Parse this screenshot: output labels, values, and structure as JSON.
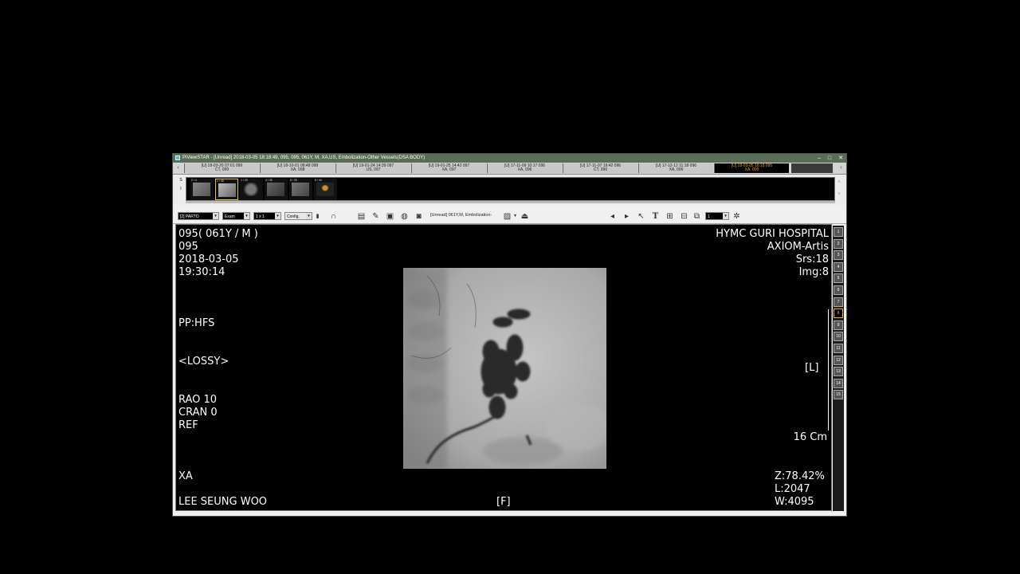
{
  "window": {
    "title": "PiViewSTAR - [Unread] 2018-03-05 18:18:49, 095, 095, 061Y, M, XA,US, Embolization-Other Vessels(DSA BODY)",
    "controls": [
      "–",
      "□",
      "✕"
    ]
  },
  "tabs": [
    {
      "line1": "[U] 18-03-20 07:01  099",
      "line2": "CT, 099",
      "active": false
    },
    {
      "line1": "[U] 18-10-01 08:48  098",
      "line2": "XA, 098",
      "active": false
    },
    {
      "line1": "[U] 19-01-24 14:39  097",
      "line2": "US, 097",
      "active": false
    },
    {
      "line1": "[U] 19-01-25 14:42  097",
      "line2": "XA, 097",
      "active": false
    },
    {
      "line1": "[U] 17-11-09 10:17  096",
      "line2": "XA, 096",
      "active": false
    },
    {
      "line1": "[U] 17-11-07 19:42  096",
      "line2": "CT, 096",
      "active": false
    },
    {
      "line1": "[U] 17-12-12 11:18  096",
      "line2": "XA, 096",
      "active": false
    },
    {
      "line1": "[U] 18-03-05 18:18  095",
      "line2": "XA, 095",
      "active": true
    }
  ],
  "thumbnails": {
    "side_labels": [
      "S",
      "I"
    ],
    "items": [
      {
        "label": "2 / 4"
      },
      {
        "label": "1 / 45"
      },
      {
        "label": "1 / 25"
      },
      {
        "label": "4 / 35"
      },
      {
        "label": "8 / 25"
      },
      {
        "label": "6 / 44"
      }
    ]
  },
  "toolbar": {
    "layout_select": "[2] PARTO",
    "exam_select": "Exam",
    "grid_select": "1 x 1",
    "config_select": "Config.",
    "study_info": "[Unread] 061Y,M, Embolization-",
    "frame_select": "1"
  },
  "overlay": {
    "top_left": [
      "095( 061Y / M )",
      "095",
      "2018-03-05",
      "19:30:14"
    ],
    "patient_position": "PP:HFS",
    "compression": "<LOSSY>",
    "angles": [
      "RAO 10",
      "CRAN 0",
      "REF"
    ],
    "modality": "XA",
    "patient_name": "LEE SEUNG WOO",
    "bottom_center": "[F]",
    "top_right": [
      "HYMC GURI HOSPITAL",
      "AXIOM-Artis",
      "Srs:18",
      "Img:8"
    ],
    "side_marker": "[L]",
    "scale": "16 Cm",
    "bottom_right": [
      "Z:78.42%",
      "L:2047",
      "W:4095"
    ]
  },
  "series_buttons": [
    "1",
    "2",
    "3",
    "4",
    "5",
    "6",
    "7",
    "8",
    "9",
    "10",
    "11",
    "12",
    "13",
    "14",
    "15"
  ],
  "active_series": "8"
}
